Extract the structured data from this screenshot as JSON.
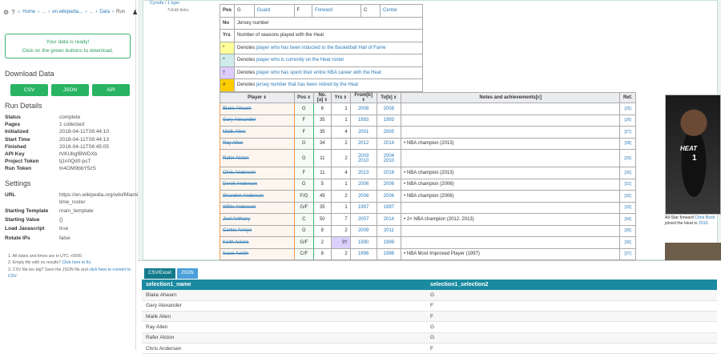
{
  "sidebar": {
    "crumbs": [
      "Home",
      "...",
      "en.wikipedia...",
      "...",
      "Data",
      "Run"
    ],
    "ready_line1": "Your data is ready!",
    "ready_line2": "Click on the green buttons to download.",
    "download_title": "Download Data",
    "buttons": [
      "CSV",
      "JSON",
      "API"
    ],
    "run_details_title": "Run Details",
    "details": [
      {
        "k": "Status",
        "v": "complete"
      },
      {
        "k": "Pages",
        "v": "1 collected"
      },
      {
        "k": "Initialized",
        "v": "2018-04-11T08:44:10"
      },
      {
        "k": "Start Time",
        "v": "2018-04-11T08:44:13"
      },
      {
        "k": "Finished",
        "v": "2018-04-11T08:45:05"
      },
      {
        "k": "API Key",
        "v": "tVKUbgfBWDXb"
      },
      {
        "k": "Project Token",
        "v": "tj1n0Qd0-psT"
      },
      {
        "k": "Run Token",
        "v": "tn4OM9bbY5zS"
      }
    ],
    "settings_title": "Settings",
    "settings": [
      {
        "k": "URL",
        "v": "https://en.wikipedia.org/wiki/Miami_Heat_all-time_roster"
      },
      {
        "k": "Starting Template",
        "v": "main_template"
      },
      {
        "k": "Starting Value",
        "v": "{}"
      },
      {
        "k": "Load Javascript",
        "v": "true"
      },
      {
        "k": "Rotate IPs",
        "v": "false"
      }
    ],
    "notes": {
      "n1": "1. All dates and times are in UTC +0000.",
      "n2a": "2. Empty file with no results?",
      "n2b": "Click here to fix.",
      "n3a": "3. CSV file too big?",
      "n3b": "Save the JSON file and",
      "n3c": "click here to convert to CSV."
    }
  },
  "main": {
    "top_link": "Cynofa / 1 typo",
    "edit_links": "Edit links",
    "legend": [
      {
        "sym": "Pos",
        "c2": "G",
        "c3": "Guard",
        "c4": "F",
        "c5": "Forward",
        "c6": "C",
        "c7": "Center"
      },
      {
        "sym": "No",
        "text": "Jersey number"
      },
      {
        "sym": "Yrs",
        "text": "Number of seasons played with the Heat"
      },
      {
        "sym": "*",
        "pre": "Denotes ",
        "link": "player who has been inducted to the Basketball Hall of Fame",
        "color": "#ffff99"
      },
      {
        "sym": "^",
        "pre": "Denotes ",
        "link": "player who is currently on the Heat roster",
        "color": "#cfecec"
      },
      {
        "sym": "†",
        "pre": "Denotes ",
        "link": "player who has spent their entire NBA career with the Heat",
        "color": "#ddccff"
      },
      {
        "sym": "#",
        "pre": "Denotes ",
        "link": "jersey number that has been retired by the Heat",
        "color": "#ffcc00"
      }
    ],
    "headers": [
      "Player",
      "Pos",
      "No.[a]",
      "Yrs",
      "From[b]",
      "To[b]",
      "Notes and achievements[c]",
      "Ref."
    ],
    "rows": [
      {
        "p": "Blake Ahearn",
        "pos": "G",
        "no": "6",
        "yrs": "1",
        "from": "2008",
        "to": "2008",
        "notes": "",
        "ref": "[25]"
      },
      {
        "p": "Gary Alexander",
        "pos": "F",
        "no": "35",
        "yrs": "1",
        "from": "1993",
        "to": "1993",
        "notes": "",
        "ref": "[26]"
      },
      {
        "p": "Malik Allen",
        "pos": "F",
        "no": "35",
        "yrs": "4",
        "from": "2001",
        "to": "2005",
        "notes": "",
        "ref": "[27]"
      },
      {
        "p": "Ray Allen",
        "pos": "G",
        "no": "34",
        "yrs": "2",
        "from": "2012",
        "to": "2014",
        "notes": "• NBA champion (2013)",
        "ref": "[28]"
      },
      {
        "p": "Rafer Alston",
        "pos": "G",
        "no": "11",
        "yrs": "2",
        "from": "2003 2010",
        "to": "2004 2010",
        "notes": "",
        "ref": "[29]"
      },
      {
        "p": "Chris Andersen",
        "pos": "F",
        "no": "11",
        "yrs": "4",
        "from": "2013",
        "to": "2016",
        "notes": "• NBA champion (2013)",
        "ref": "[30]"
      },
      {
        "p": "Derek Anderson",
        "pos": "G",
        "no": "5",
        "yrs": "1",
        "from": "2006",
        "to": "2006",
        "notes": "• NBA champion (2006)",
        "ref": "[31]"
      },
      {
        "p": "Shandon Anderson",
        "pos": "F/G",
        "no": "49",
        "yrs": "2",
        "from": "2006",
        "to": "2006",
        "notes": "• NBA champion (2006)",
        "ref": "[32]"
      },
      {
        "p": "Willie Anderson",
        "pos": "G/F",
        "no": "35",
        "yrs": "1",
        "from": "1997",
        "to": "1997",
        "notes": "",
        "ref": "[33]"
      },
      {
        "p": "Joel Anthony",
        "pos": "C",
        "no": "50",
        "yrs": "7",
        "from": "2007",
        "to": "2014",
        "notes": "• 2× NBA champion (2012, 2013)",
        "ref": "[34]"
      },
      {
        "p": "Carlos Arroyo",
        "pos": "G",
        "no": "8",
        "yrs": "2",
        "from": "2009",
        "to": "2011",
        "notes": "",
        "ref": "[35]"
      },
      {
        "p": "Keith Askins",
        "pos": "G/F",
        "no": "2",
        "yrs": "9†",
        "from": "1990",
        "to": "1999",
        "notes": "",
        "ref": "[36]",
        "hl": true
      },
      {
        "p": "Isaac Austin",
        "pos": "C/F",
        "no": "8",
        "yrs": "2",
        "from": "1996",
        "to": "1998",
        "notes": "• NBA Most Improved Player (1997)",
        "ref": "[37]"
      }
    ],
    "photo_heat": "HEAT",
    "photo_num": "1",
    "caption_pre": "All-Star forward ",
    "caption_link": "Chris Bosh",
    "caption_post": " joined the Heat in ",
    "caption_year": "2010",
    "caption_end": "."
  },
  "bottom": {
    "tabs": [
      "CSV/Excel",
      "JSON"
    ],
    "columns": [
      "selection1_name",
      "selection1_selection2"
    ],
    "rows": [
      [
        "Blake Ahearn",
        "G"
      ],
      [
        "Gary Alexander",
        "F"
      ],
      [
        "Malik Allen",
        "F"
      ],
      [
        "Ray Allen",
        "G"
      ],
      [
        "Rafer Alston",
        "G"
      ],
      [
        "Chris Andersen",
        "F"
      ]
    ]
  },
  "colors": {
    "accent": "#28b463",
    "teal": "#1a8aa0",
    "link": "#2a7ab8"
  }
}
